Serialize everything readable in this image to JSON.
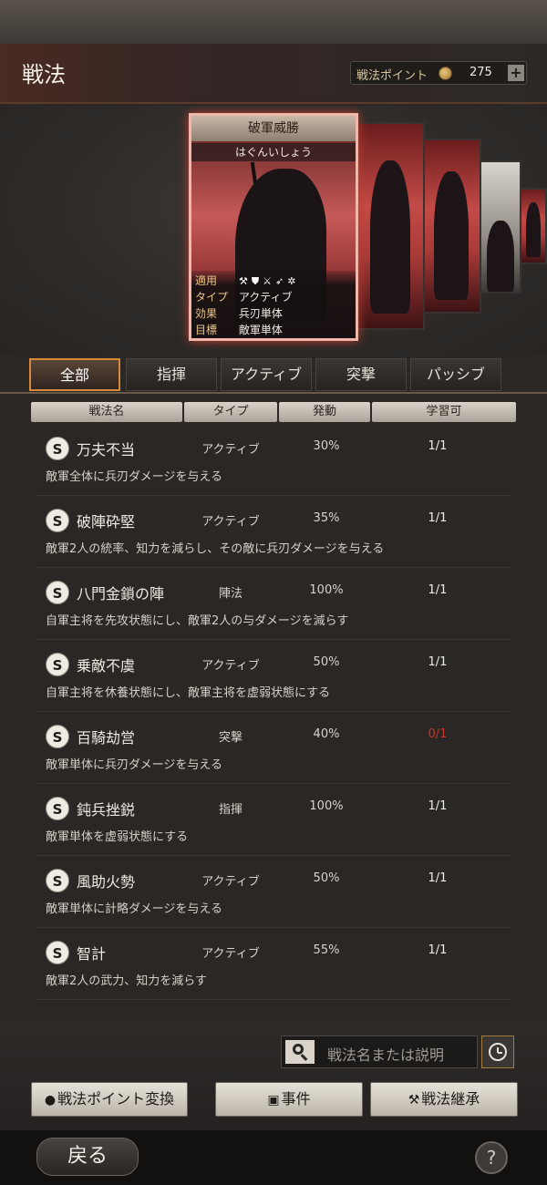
{
  "header": {
    "title": "戦法",
    "points_label": "戦法ポイント",
    "points_value": "275",
    "plus_label": "+"
  },
  "featured_card": {
    "name": "破軍威勝",
    "reading": "はぐんいしょう",
    "applicable_label": "適用",
    "applicable_icons": [
      "axe-icon",
      "shield-icon",
      "crossed-swords-icon",
      "spear-icon",
      "wheel-icon"
    ],
    "type_label": "タイプ",
    "type_value": "アクティブ",
    "effect_label": "効果",
    "effect_value": "兵刃単体",
    "target_label": "目標",
    "target_value": "敵軍単体"
  },
  "tabs": [
    {
      "label": "全部",
      "active": true
    },
    {
      "label": "指揮",
      "active": false
    },
    {
      "label": "アクティブ",
      "active": false
    },
    {
      "label": "突撃",
      "active": false
    },
    {
      "label": "パッシブ",
      "active": false
    }
  ],
  "columns": {
    "name": "戦法名",
    "type": "タイプ",
    "rate": "発動",
    "learnable": "学習可"
  },
  "rows": [
    {
      "grade": "S",
      "name": "万夫不当",
      "type": "アクティブ",
      "rate": "30%",
      "learnable": "1/1",
      "description": "敵軍全体に兵刃ダメージを与える"
    },
    {
      "grade": "S",
      "name": "破陣砕堅",
      "type": "アクティブ",
      "rate": "35%",
      "learnable": "1/1",
      "description": "敵軍2人の統率、知力を減らし、その敵に兵刃ダメージを与える"
    },
    {
      "grade": "S",
      "name": "八門金鎖の陣",
      "type": "陣法",
      "rate": "100%",
      "learnable": "1/1",
      "description": "自軍主将を先攻状態にし、敵軍2人の与ダメージを減らす"
    },
    {
      "grade": "S",
      "name": "乗敵不虞",
      "type": "アクティブ",
      "rate": "50%",
      "learnable": "1/1",
      "description": "自軍主将を休養状態にし、敵軍主将を虚弱状態にする"
    },
    {
      "grade": "S",
      "name": "百騎劫営",
      "type": "突撃",
      "rate": "40%",
      "learnable": "0/1",
      "description": "敵軍単体に兵刃ダメージを与える"
    },
    {
      "grade": "S",
      "name": "鈍兵挫鋭",
      "type": "指揮",
      "rate": "100%",
      "learnable": "1/1",
      "description": "敵軍単体を虚弱状態にする"
    },
    {
      "grade": "S",
      "name": "風助火勢",
      "type": "アクティブ",
      "rate": "50%",
      "learnable": "1/1",
      "description": "敵軍単体に計略ダメージを与える"
    },
    {
      "grade": "S",
      "name": "智計",
      "type": "アクティブ",
      "rate": "55%",
      "learnable": "1/1",
      "description": "敵軍2人の武力、知力を減らす"
    }
  ],
  "search": {
    "placeholder": "戦法名または説明"
  },
  "actions": {
    "convert_label": "戦法ポイント変換",
    "event_label": "事件",
    "inherit_label": "戦法継承"
  },
  "footer": {
    "back_label": "戻る",
    "help_label": "?"
  },
  "colors": {
    "accent_tab": "#d7883a",
    "zero_learnable": "#c8352a"
  }
}
